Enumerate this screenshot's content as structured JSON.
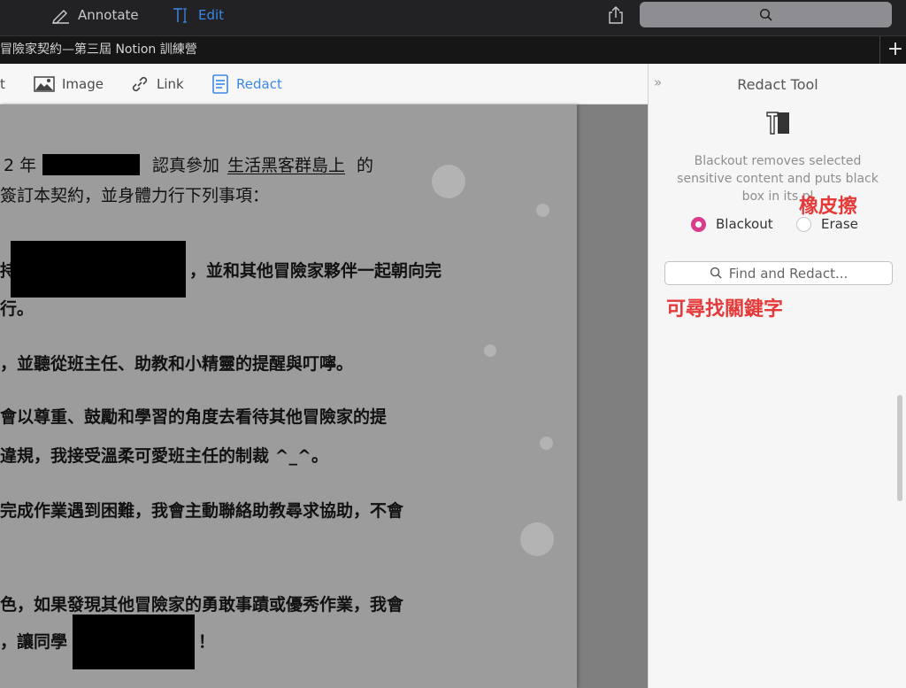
{
  "toolbar": {
    "annotate_label": "Annotate",
    "edit_label": "Edit"
  },
  "tab": {
    "title": "冒險家契約—第三屆 Notion 訓練營"
  },
  "edit_tools": {
    "text_label": "t",
    "image_label": "Image",
    "link_label": "Link",
    "redact_label": "Redact"
  },
  "document": {
    "lines": [
      {
        "text": "2 年"
      },
      {
        "text": "認真參加"
      },
      {
        "text": "生活黑客群島上"
      },
      {
        "text": "的"
      },
      {
        "text": "簽訂本契約，並身體力行下列事項："
      },
      {
        "text": "持"
      },
      {
        "text": "，並和其他冒險家夥伴一起朝向完"
      },
      {
        "text": "行。"
      },
      {
        "text": "，並聽從班主任、助教和小精靈的提醒與叮嚀。"
      },
      {
        "text": "會以尊重、鼓勵和學習的角度去看待其他冒險家的提"
      },
      {
        "text": "違規，我接受溫柔可愛班主任的制裁 ^_^。"
      },
      {
        "text": "完成作業遇到困難，我會主動聯絡助教尋求協助，不會"
      },
      {
        "text": "色，如果發現其他冒險家的勇敢事蹟或優秀作業，我會"
      },
      {
        "text": "，讓同學"
      },
      {
        "text": "！"
      }
    ]
  },
  "panel": {
    "title": "Redact Tool",
    "description": "Blackout removes selected sensitive content and puts black box in its pl",
    "blackout_label": "Blackout",
    "erase_label": "Erase",
    "find_placeholder": "Find and Redact...",
    "selected_mode": "Blackout"
  },
  "annotations": {
    "eraser": "橡皮擦",
    "find_keyword": "可尋找關鍵字"
  },
  "colors": {
    "accent_blue": "#3d87e6",
    "radio_pink": "#d83c8a",
    "annotation_red": "#e53a3a"
  },
  "icons": {
    "annotate": "pen-icon",
    "edit": "text-cursor-icon",
    "share": "share-icon",
    "search": "magnifier-icon",
    "image": "image-icon",
    "link": "link-icon",
    "redact": "document-icon",
    "collapse": "double-chevron-right-icon",
    "redact_tool": "redact-tool-icon"
  }
}
